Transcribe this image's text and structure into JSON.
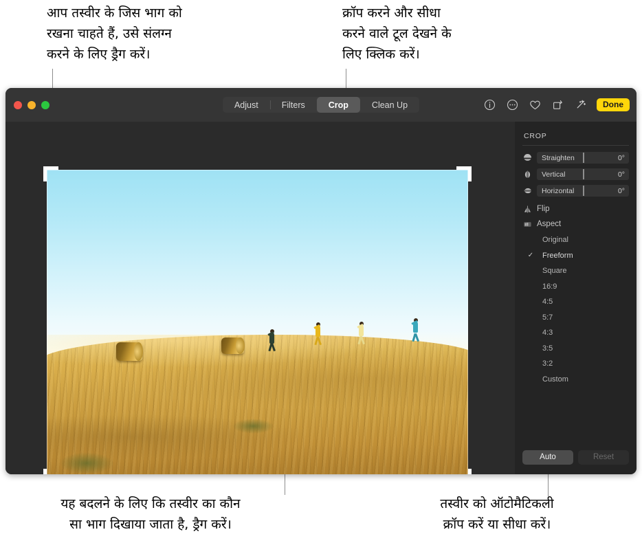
{
  "annotations": {
    "top_left": "आप तस्वीर के जिस भाग को\nरखना चाहते हैं, उसे संलग्न\nकरने के लिए ड्रैग करें।",
    "top_right": "क्रॉप करने और सीधा\nकरने वाले टूल देखने के\nलिए क्लिक करें।",
    "bottom_left": "यह बदलने के लिए कि तस्वीर का कौन\nसा भाग दिखाया जाता है, ड्रैग करें।",
    "bottom_right": "तस्वीर को ऑटोमैटिकली\nक्रॉप करें या सीधा करें।"
  },
  "window": {
    "titlebar": {
      "traffic_lights": [
        {
          "name": "close",
          "color": "#f3564c"
        },
        {
          "name": "minimize",
          "color": "#f7b22b"
        },
        {
          "name": "zoom",
          "color": "#2bc63f"
        }
      ],
      "segmented_control": [
        {
          "label": "Adjust",
          "selected": false
        },
        {
          "label": "Filters",
          "selected": false
        },
        {
          "label": "Crop",
          "selected": true
        },
        {
          "label": "Clean Up",
          "selected": false
        }
      ],
      "tools": [
        {
          "icon": "info-icon"
        },
        {
          "icon": "more-ellipsis-icon"
        },
        {
          "icon": "heart-icon"
        },
        {
          "icon": "rotate-icon"
        },
        {
          "icon": "magic-wand-icon"
        }
      ],
      "done_label": "Done",
      "done_color": "#ffd60a"
    },
    "sidebar": {
      "title": "CROP",
      "sliders": [
        {
          "icon": "straighten-icon",
          "label": "Straighten",
          "value": "0°"
        },
        {
          "icon": "vertical-icon",
          "label": "Vertical",
          "value": "0°"
        },
        {
          "icon": "horizontal-icon",
          "label": "Horizontal",
          "value": "0°"
        }
      ],
      "menus": [
        {
          "icon": "flip-icon",
          "label": "Flip"
        },
        {
          "icon": "aspect-icon",
          "label": "Aspect"
        }
      ],
      "aspect_options": [
        {
          "label": "Original",
          "selected": false
        },
        {
          "label": "Freeform",
          "selected": true
        },
        {
          "label": "Square",
          "selected": false
        },
        {
          "label": "16:9",
          "selected": false
        },
        {
          "label": "4:5",
          "selected": false
        },
        {
          "label": "5:7",
          "selected": false
        },
        {
          "label": "4:3",
          "selected": false
        },
        {
          "label": "3:5",
          "selected": false
        },
        {
          "label": "3:2",
          "selected": false
        },
        {
          "label": "Custom",
          "selected": false
        }
      ],
      "checkmark": "✓",
      "footer": {
        "auto_label": "Auto",
        "reset_label": "Reset"
      }
    },
    "canvas": {
      "photo_alt": "children running across a golden stubble field with hay bales under a pale blue sky",
      "crop_handles": [
        "top-left",
        "top-right",
        "bottom-left",
        "bottom-right"
      ]
    }
  }
}
